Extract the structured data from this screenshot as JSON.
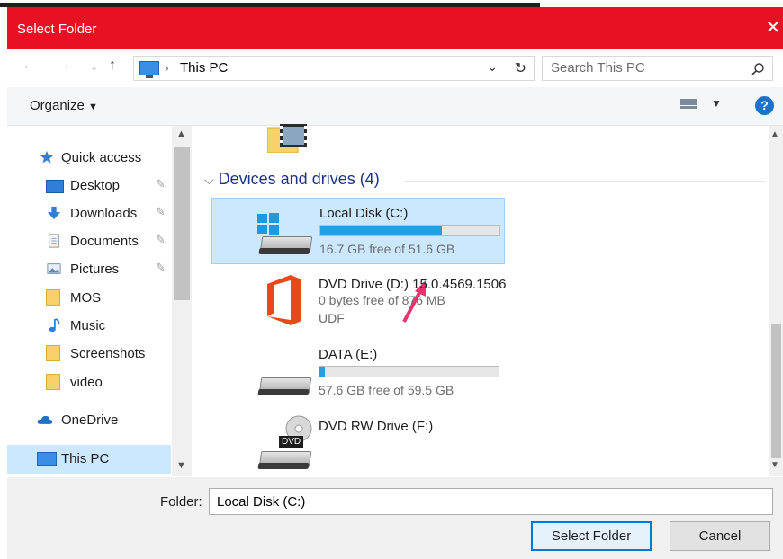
{
  "window": {
    "title": "Select Folder",
    "close_icon": "close-icon"
  },
  "nav": {
    "address_segment": "This PC",
    "search_placeholder": "Search This PC"
  },
  "toolbar": {
    "organize_label": "Organize"
  },
  "sidebar": {
    "items": [
      {
        "label": "Quick access",
        "icon": "star-icon",
        "pinned": false
      },
      {
        "label": "Desktop",
        "icon": "desktop-icon",
        "pinned": true
      },
      {
        "label": "Downloads",
        "icon": "download-icon",
        "pinned": true
      },
      {
        "label": "Documents",
        "icon": "documents-icon",
        "pinned": true
      },
      {
        "label": "Pictures",
        "icon": "pictures-icon",
        "pinned": true
      },
      {
        "label": "MOS",
        "icon": "folder-icon",
        "pinned": false
      },
      {
        "label": "Music",
        "icon": "music-icon",
        "pinned": false
      },
      {
        "label": "Screenshots",
        "icon": "folder-icon",
        "pinned": false
      },
      {
        "label": "video",
        "icon": "folder-icon",
        "pinned": false
      },
      {
        "label": "OneDrive",
        "icon": "cloud-icon",
        "pinned": false
      },
      {
        "label": "This PC",
        "icon": "computer-icon",
        "pinned": false,
        "selected": true
      }
    ]
  },
  "content": {
    "group_title": "Devices and drives (4)",
    "drives": [
      {
        "name": "Local Disk (C:)",
        "free_text": "16.7 GB free of 51.6 GB",
        "used_fraction": 0.68,
        "selected": true
      },
      {
        "name": "DVD Drive (D:) 15.0.4569.1506",
        "free_text": "0 bytes free of 876 MB",
        "fs": "UDF"
      },
      {
        "name": "DATA (E:)",
        "free_text": "57.6 GB free of 59.5 GB",
        "used_fraction": 0.03
      },
      {
        "name": "DVD RW Drive (F:)",
        "badge": "DVD"
      }
    ]
  },
  "footer": {
    "folder_label": "Folder:",
    "folder_value": "Local Disk (C:)",
    "select_label": "Select Folder",
    "cancel_label": "Cancel"
  },
  "colors": {
    "title_bar": "#e81123",
    "selection": "#cce8ff",
    "progress": "#26a0da",
    "arrow": "#e8336d"
  }
}
